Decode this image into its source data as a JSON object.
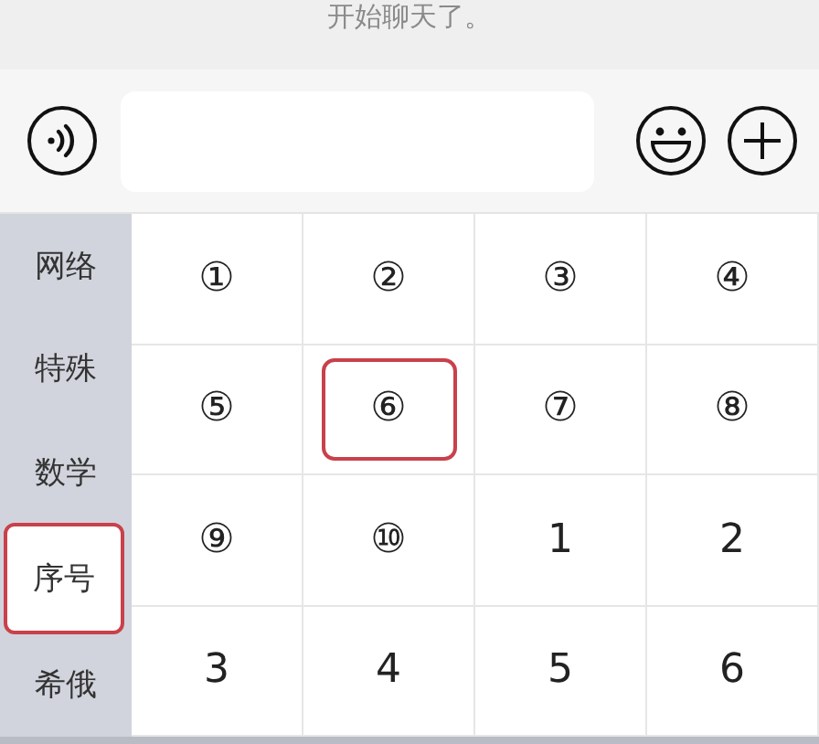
{
  "chat": {
    "message": "开始聊天了。"
  },
  "keyboard": {
    "categories": [
      {
        "label": "网络",
        "selected": false
      },
      {
        "label": "特殊",
        "selected": false
      },
      {
        "label": "数学",
        "selected": false
      },
      {
        "label": "序号",
        "selected": true
      },
      {
        "label": "希俄",
        "selected": false
      }
    ],
    "keys": [
      {
        "label": "①",
        "highlighted": false
      },
      {
        "label": "②",
        "highlighted": false
      },
      {
        "label": "③",
        "highlighted": false
      },
      {
        "label": "④",
        "highlighted": false
      },
      {
        "label": "⑤",
        "highlighted": false
      },
      {
        "label": "⑥",
        "highlighted": true
      },
      {
        "label": "⑦",
        "highlighted": false
      },
      {
        "label": "⑧",
        "highlighted": false
      },
      {
        "label": "⑨",
        "highlighted": false
      },
      {
        "label": "⑩",
        "highlighted": false
      },
      {
        "label": "1",
        "highlighted": false
      },
      {
        "label": "2",
        "highlighted": false
      },
      {
        "label": "3",
        "highlighted": false
      },
      {
        "label": "4",
        "highlighted": false
      },
      {
        "label": "5",
        "highlighted": false
      },
      {
        "label": "6",
        "highlighted": false
      }
    ]
  }
}
